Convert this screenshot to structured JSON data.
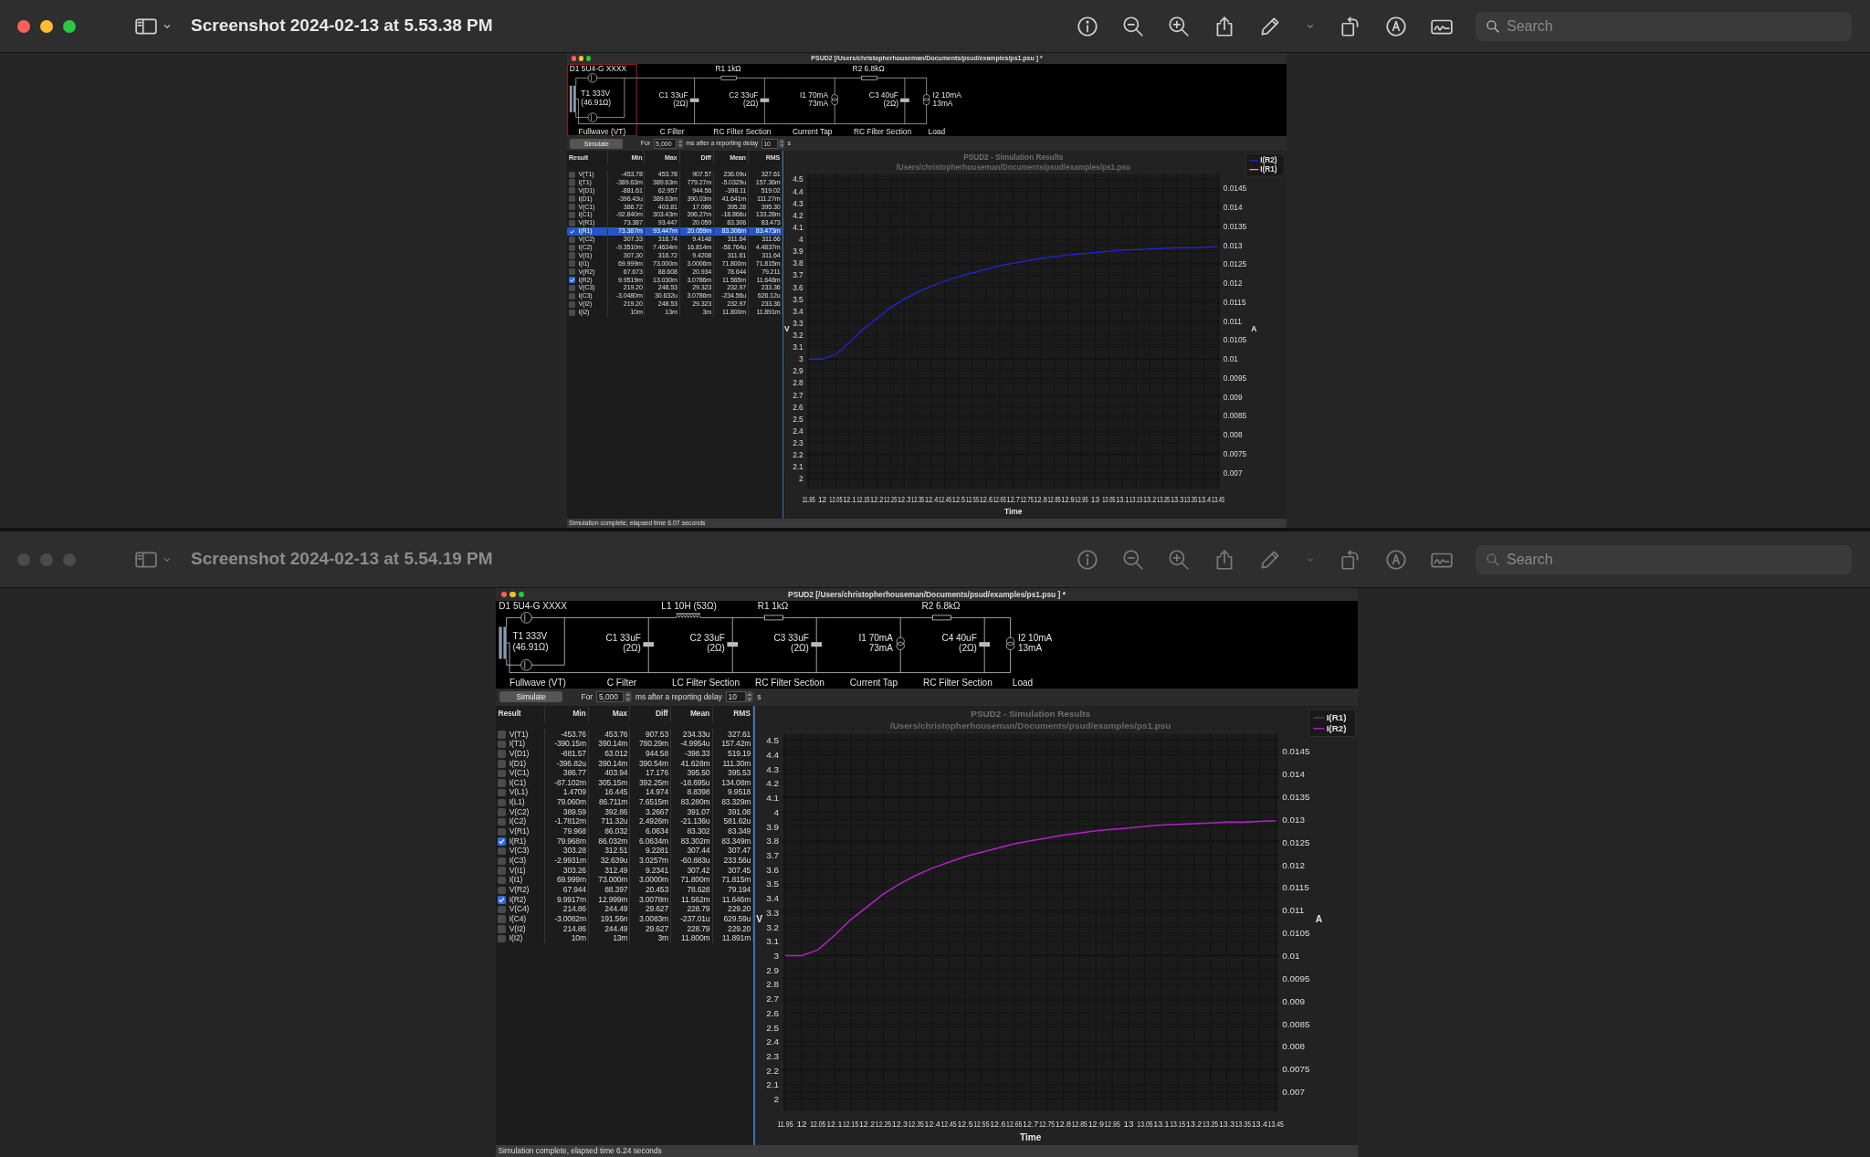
{
  "windows": [
    {
      "active": true,
      "title": "Screenshot 2024-02-13 at 5.53.38 PM",
      "search": {
        "placeholder": "Search"
      },
      "app": {
        "title": "PSUD2  [/Users/christopherhouseman/Documents/psud/examples/ps1.psu ] *",
        "schematic": [
          {
            "kind": "rectifier",
            "selected": true,
            "labels": [
              "D1 5U4-G XXXX",
              "T1 333V",
              "(46.91Ω)"
            ],
            "section": "Fullwave (VT)"
          },
          {
            "kind": "filter",
            "labels": [
              "C1 33uF",
              "(2Ω)"
            ],
            "section": "C Filter"
          },
          {
            "kind": "filter",
            "series_element": {
              "kind": "resistor",
              "label": "R1 1kΩ"
            },
            "labels": [
              "C2 33uF",
              "(2Ω)"
            ],
            "section": "RC Filter Section"
          },
          {
            "kind": "tap",
            "labels": [
              "I1 70mA",
              "73mA"
            ],
            "section": "Current Tap"
          },
          {
            "kind": "filter",
            "series_element": {
              "kind": "resistor",
              "label": "R2 6.8kΩ"
            },
            "labels": [
              "C3 40uF",
              "(2Ω)"
            ],
            "section": "RC Filter Section"
          },
          {
            "kind": "load",
            "labels": [
              "I2 10mA",
              "13mA"
            ],
            "section": "Load"
          }
        ],
        "simulate": {
          "button": "Simulate",
          "for_label": "For",
          "duration": "5,000",
          "after_label": "ms after a reporting delay",
          "delay": "10",
          "unit": "s"
        },
        "results": {
          "columns": [
            "Result",
            "Min",
            "Max",
            "Diff",
            "Mean",
            "RMS"
          ],
          "rows": [
            {
              "result": "V(T1)",
              "values": [
                "-453.78",
                "453.78",
                "907.57",
                "236.09u",
                "327.61"
              ],
              "checked": false,
              "selected": false
            },
            {
              "result": "I(T1)",
              "values": [
                "-389.63m",
                "389.63m",
                "779.27m",
                "-5.0329u",
                "157.36m"
              ],
              "checked": false,
              "selected": false
            },
            {
              "result": "V(D1)",
              "values": [
                "-881.61",
                "62.957",
                "944.56",
                "-398.11",
                "519.02"
              ],
              "checked": false,
              "selected": false
            },
            {
              "result": "I(D1)",
              "values": [
                "-396.43u",
                "389.63m",
                "390.03m",
                "41.641m",
                "111.27m"
              ],
              "checked": false,
              "selected": false
            },
            {
              "result": "V(C1)",
              "values": [
                "386.72",
                "403.81",
                "17.086",
                "395.28",
                "395.30"
              ],
              "checked": false,
              "selected": false
            },
            {
              "result": "I(C1)",
              "values": [
                "-92.840m",
                "303.43m",
                "396.27m",
                "-18.866u",
                "133.28m"
              ],
              "checked": false,
              "selected": false
            },
            {
              "result": "V(R1)",
              "values": [
                "73.387",
                "93.447",
                "20.059",
                "83.306",
                "83.473"
              ],
              "checked": false,
              "selected": false
            },
            {
              "result": "I(R1)",
              "values": [
                "73.387m",
                "93.447m",
                "20.059m",
                "83.306m",
                "83.473m"
              ],
              "checked": true,
              "selected": true
            },
            {
              "result": "V(C2)",
              "values": [
                "307.33",
                "316.74",
                "9.4148",
                "311.64",
                "311.66"
              ],
              "checked": false,
              "selected": false
            },
            {
              "result": "I(C2)",
              "values": [
                "-9.3510m",
                "7.4634m",
                "16.814m",
                "-58.764u",
                "4.4837m"
              ],
              "checked": false,
              "selected": false
            },
            {
              "result": "V(I1)",
              "values": [
                "307.30",
                "316.72",
                "9.4208",
                "311.61",
                "311.64"
              ],
              "checked": false,
              "selected": false
            },
            {
              "result": "I(I1)",
              "values": [
                "69.999m",
                "73.000m",
                "3.0006m",
                "71.800m",
                "71.815m"
              ],
              "checked": false,
              "selected": false
            },
            {
              "result": "V(R2)",
              "values": [
                "67.673",
                "88.608",
                "20.934",
                "78.644",
                "79.211"
              ],
              "checked": false,
              "selected": false
            },
            {
              "result": "I(R2)",
              "values": [
                "9.9519m",
                "13.030m",
                "3.0786m",
                "11.565m",
                "11.648m"
              ],
              "checked": true,
              "selected": false
            },
            {
              "result": "V(C3)",
              "values": [
                "219.20",
                "248.53",
                "29.323",
                "232.97",
                "233.36"
              ],
              "checked": false,
              "selected": false
            },
            {
              "result": "I(C3)",
              "values": [
                "-3.0480m",
                "30.632u",
                "3.0786m",
                "-234.56u",
                "626.12u"
              ],
              "checked": false,
              "selected": false
            },
            {
              "result": "V(I2)",
              "values": [
                "219.20",
                "248.53",
                "29.323",
                "232.97",
                "233.36"
              ],
              "checked": false,
              "selected": false
            },
            {
              "result": "I(I2)",
              "values": [
                "10m",
                "13m",
                "3m",
                "11.800m",
                "11.891m"
              ],
              "checked": false,
              "selected": false
            }
          ]
        },
        "chart": {
          "subtitle": "/Users/christopherhouseman/Documents/psud/examples/ps1.psu",
          "right_axis": {
            "label": "A",
            "ticks": [
              "0.0145",
              "0.014",
              "0.0135",
              "0.013",
              "0.0125",
              "0.012",
              "0.0115",
              "0.011",
              "0.0105",
              "0.01",
              "0.0095",
              "0.009",
              "0.0085",
              "0.008",
              "0.0075",
              "0.007"
            ]
          },
          "chart_data": {
            "type": "line",
            "title": "PSUD2 - Simulation Results",
            "xlabel": "Time",
            "ylabel": "V",
            "grid": true,
            "x": [
              11.95,
              12,
              12.05,
              12.1,
              12.15,
              12.2,
              12.25,
              12.3,
              12.35,
              12.4,
              12.45,
              12.5,
              12.55,
              12.6,
              12.65,
              12.7,
              12.75,
              12.8,
              12.85,
              12.9,
              12.95,
              13,
              13.05,
              13.1,
              13.15,
              13.2,
              13.25,
              13.3,
              13.35,
              13.4,
              13.45
            ],
            "series": [
              {
                "name": "I(R2)",
                "color": "#2323e8",
                "values": [
                  3.0,
                  3.0,
                  3.04,
                  3.14,
                  3.25,
                  3.34,
                  3.43,
                  3.5,
                  3.56,
                  3.61,
                  3.65,
                  3.69,
                  3.72,
                  3.75,
                  3.78,
                  3.8,
                  3.82,
                  3.84,
                  3.855,
                  3.87,
                  3.88,
                  3.89,
                  3.9,
                  3.91,
                  3.915,
                  3.92,
                  3.925,
                  3.93,
                  3.93,
                  3.935,
                  3.94
                ]
              },
              {
                "name": "I(R1)",
                "color": "#e0d020",
                "values": [
                  null,
                  null,
                  null,
                  null,
                  null,
                  null,
                  null,
                  null,
                  null,
                  null,
                  null,
                  null,
                  null,
                  null,
                  null,
                  null,
                  null,
                  null,
                  null,
                  null,
                  null,
                  null,
                  null,
                  null,
                  null,
                  null,
                  null,
                  null,
                  null,
                  null,
                  null
                ]
              }
            ],
            "xlim": [
              11.94,
              13.46
            ],
            "ylim": [
              1.91,
              4.55
            ],
            "xticks": [
              11.95,
              12,
              12.05,
              12.1,
              12.15,
              12.2,
              12.25,
              12.3,
              12.35,
              12.4,
              12.45,
              12.5,
              12.55,
              12.6,
              12.65,
              12.7,
              12.75,
              12.8,
              12.85,
              12.9,
              12.95,
              13,
              13.05,
              13.1,
              13.15,
              13.2,
              13.25,
              13.3,
              13.35,
              13.4,
              13.45
            ],
            "yticks": [
              2,
              2.1,
              2.2,
              2.3,
              2.4,
              2.5,
              2.6,
              2.7,
              2.8,
              2.9,
              3,
              3.1,
              3.2,
              3.3,
              3.4,
              3.5,
              3.6,
              3.7,
              3.8,
              3.9,
              4,
              4.1,
              4.2,
              4.3,
              4.4,
              4.5
            ]
          }
        },
        "status": "Simulation complete, elapsed time 6.07 seconds"
      }
    },
    {
      "active": false,
      "title": "Screenshot 2024-02-13 at 5.54.19 PM",
      "search": {
        "placeholder": "Search"
      },
      "app": {
        "title": "PSUD2  [/Users/christopherhouseman/Documents/psud/examples/ps1.psu ] *",
        "schematic": [
          {
            "kind": "rectifier",
            "selected": false,
            "labels": [
              "D1 5U4-G XXXX",
              "T1 333V",
              "(46.91Ω)"
            ],
            "section": "Fullwave (VT)"
          },
          {
            "kind": "filter",
            "labels": [
              "C1 33uF",
              "(2Ω)"
            ],
            "section": "C Filter"
          },
          {
            "kind": "filter",
            "series_element": {
              "kind": "inductor",
              "label": "L1 10H (53Ω)"
            },
            "labels": [
              "C2 33uF",
              "(2Ω)"
            ],
            "section": "LC Filter Section"
          },
          {
            "kind": "filter",
            "series_element": {
              "kind": "resistor",
              "label": "R1 1kΩ"
            },
            "labels": [
              "C3 33uF",
              "(2Ω)"
            ],
            "section": "RC Filter Section"
          },
          {
            "kind": "tap",
            "labels": [
              "I1 70mA",
              "73mA"
            ],
            "section": "Current Tap"
          },
          {
            "kind": "filter",
            "series_element": {
              "kind": "resistor",
              "label": "R2 6.8kΩ"
            },
            "labels": [
              "C4 40uF",
              "(2Ω)"
            ],
            "section": "RC Filter Section"
          },
          {
            "kind": "load",
            "labels": [
              "I2 10mA",
              "13mA"
            ],
            "section": "Load"
          }
        ],
        "simulate": {
          "button": "Simulate",
          "for_label": "For",
          "duration": "5,000",
          "after_label": "ms after a reporting delay",
          "delay": "10",
          "unit": "s"
        },
        "results": {
          "columns": [
            "Result",
            "Min",
            "Max",
            "Diff",
            "Mean",
            "RMS"
          ],
          "rows": [
            {
              "result": "V(T1)",
              "values": [
                "-453.76",
                "453.76",
                "907.53",
                "234.33u",
                "327.61"
              ],
              "checked": false,
              "selected": false
            },
            {
              "result": "I(T1)",
              "values": [
                "-390.15m",
                "390.14m",
                "780.29m",
                "-4.9954u",
                "157.42m"
              ],
              "checked": false,
              "selected": false
            },
            {
              "result": "V(D1)",
              "values": [
                "-881.57",
                "63.012",
                "944.58",
                "-398.33",
                "519.19"
              ],
              "checked": false,
              "selected": false
            },
            {
              "result": "I(D1)",
              "values": [
                "-396.82u",
                "390.14m",
                "390.54m",
                "41.628m",
                "111.30m"
              ],
              "checked": false,
              "selected": false
            },
            {
              "result": "V(C1)",
              "values": [
                "386.77",
                "403.94",
                "17.176",
                "395.50",
                "395.53"
              ],
              "checked": false,
              "selected": false
            },
            {
              "result": "I(C1)",
              "values": [
                "-87.102m",
                "305.15m",
                "392.25m",
                "-18.695u",
                "134.08m"
              ],
              "checked": false,
              "selected": false
            },
            {
              "result": "V(L1)",
              "values": [
                "1.4709",
                "16.445",
                "14.974",
                "8.8398",
                "9.9518"
              ],
              "checked": false,
              "selected": false
            },
            {
              "result": "I(L1)",
              "values": [
                "79.060m",
                "86.711m",
                "7.6515m",
                "83.280m",
                "83.329m"
              ],
              "checked": false,
              "selected": false
            },
            {
              "result": "V(C2)",
              "values": [
                "389.59",
                "392.86",
                "3.2667",
                "391.07",
                "391.08"
              ],
              "checked": false,
              "selected": false
            },
            {
              "result": "I(C2)",
              "values": [
                "-1.7812m",
                "711.32u",
                "2.4926m",
                "-21.136u",
                "581.62u"
              ],
              "checked": false,
              "selected": false
            },
            {
              "result": "V(R1)",
              "values": [
                "79.968",
                "86.032",
                "6.0634",
                "83.302",
                "83.349"
              ],
              "checked": false,
              "selected": false
            },
            {
              "result": "I(R1)",
              "values": [
                "79.968m",
                "86.032m",
                "6.0634m",
                "83.302m",
                "83.349m"
              ],
              "checked": true,
              "selected": false
            },
            {
              "result": "V(C3)",
              "values": [
                "303.28",
                "312.51",
                "9.2281",
                "307.44",
                "307.47"
              ],
              "checked": false,
              "selected": false
            },
            {
              "result": "I(C3)",
              "values": [
                "-2.9931m",
                "32.639u",
                "3.0257m",
                "-60.883u",
                "233.56u"
              ],
              "checked": false,
              "selected": false
            },
            {
              "result": "V(I1)",
              "values": [
                "303.26",
                "312.49",
                "9.2341",
                "307.42",
                "307.45"
              ],
              "checked": false,
              "selected": false
            },
            {
              "result": "I(I1)",
              "values": [
                "69.999m",
                "73.000m",
                "3.0000m",
                "71.800m",
                "71.815m"
              ],
              "checked": false,
              "selected": false
            },
            {
              "result": "V(R2)",
              "values": [
                "67.944",
                "88.397",
                "20.453",
                "78.628",
                "79.194"
              ],
              "checked": false,
              "selected": false
            },
            {
              "result": "I(R2)",
              "values": [
                "9.9917m",
                "12.999m",
                "3.0078m",
                "11.562m",
                "11.646m"
              ],
              "checked": true,
              "selected": false
            },
            {
              "result": "V(C4)",
              "values": [
                "214.86",
                "244.49",
                "29.627",
                "228.79",
                "229.20"
              ],
              "checked": false,
              "selected": false
            },
            {
              "result": "I(C4)",
              "values": [
                "-3.0082m",
                "191.56n",
                "3.0083m",
                "-237.01u",
                "629.59u"
              ],
              "checked": false,
              "selected": false
            },
            {
              "result": "V(I2)",
              "values": [
                "214.86",
                "244.49",
                "29.627",
                "228.79",
                "229.20"
              ],
              "checked": false,
              "selected": false
            },
            {
              "result": "I(I2)",
              "values": [
                "10m",
                "13m",
                "3m",
                "11.800m",
                "11.891m"
              ],
              "checked": false,
              "selected": false
            }
          ]
        },
        "chart": {
          "subtitle": "/Users/christopherhouseman/Documents/psud/examples/ps1.psu",
          "right_axis": {
            "label": "A",
            "ticks": [
              "0.0145",
              "0.014",
              "0.0135",
              "0.013",
              "0.0125",
              "0.012",
              "0.0115",
              "0.011",
              "0.0105",
              "0.01",
              "0.0095",
              "0.009",
              "0.0085",
              "0.008",
              "0.0075",
              "0.007"
            ]
          },
          "chart_data": {
            "type": "line",
            "title": "PSUD2 - Simulation Results",
            "xlabel": "Time",
            "ylabel": "V",
            "grid": true,
            "x": [
              11.95,
              12,
              12.05,
              12.1,
              12.15,
              12.2,
              12.25,
              12.3,
              12.35,
              12.4,
              12.45,
              12.5,
              12.55,
              12.6,
              12.65,
              12.7,
              12.75,
              12.8,
              12.85,
              12.9,
              12.95,
              13,
              13.05,
              13.1,
              13.15,
              13.2,
              13.25,
              13.3,
              13.35,
              13.4,
              13.45
            ],
            "series": [
              {
                "name": "I(R1)",
                "color": "#3c4a5e",
                "values": [
                  null,
                  null,
                  null,
                  null,
                  null,
                  null,
                  null,
                  null,
                  null,
                  null,
                  null,
                  null,
                  null,
                  null,
                  null,
                  null,
                  null,
                  null,
                  null,
                  null,
                  null,
                  null,
                  null,
                  null,
                  null,
                  null,
                  null,
                  null,
                  null,
                  null,
                  null
                ]
              },
              {
                "name": "I(R2)",
                "color": "#b51fc9",
                "values": [
                  3.0,
                  3.0,
                  3.04,
                  3.14,
                  3.25,
                  3.34,
                  3.43,
                  3.5,
                  3.56,
                  3.61,
                  3.65,
                  3.69,
                  3.72,
                  3.75,
                  3.78,
                  3.8,
                  3.82,
                  3.84,
                  3.855,
                  3.87,
                  3.88,
                  3.89,
                  3.9,
                  3.91,
                  3.915,
                  3.92,
                  3.925,
                  3.93,
                  3.93,
                  3.935,
                  3.94
                ]
              }
            ],
            "xlim": [
              11.94,
              13.46
            ],
            "ylim": [
              1.91,
              4.55
            ],
            "xticks": [
              11.95,
              12,
              12.05,
              12.1,
              12.15,
              12.2,
              12.25,
              12.3,
              12.35,
              12.4,
              12.45,
              12.5,
              12.55,
              12.6,
              12.65,
              12.7,
              12.75,
              12.8,
              12.85,
              12.9,
              12.95,
              13,
              13.05,
              13.1,
              13.15,
              13.2,
              13.25,
              13.3,
              13.35,
              13.4,
              13.45
            ],
            "yticks": [
              2,
              2.1,
              2.2,
              2.3,
              2.4,
              2.5,
              2.6,
              2.7,
              2.8,
              2.9,
              3,
              3.1,
              3.2,
              3.3,
              3.4,
              3.5,
              3.6,
              3.7,
              3.8,
              3.9,
              4,
              4.1,
              4.2,
              4.3,
              4.4,
              4.5
            ]
          }
        },
        "status": "Simulation complete, elapsed time 6.24 seconds"
      }
    }
  ]
}
